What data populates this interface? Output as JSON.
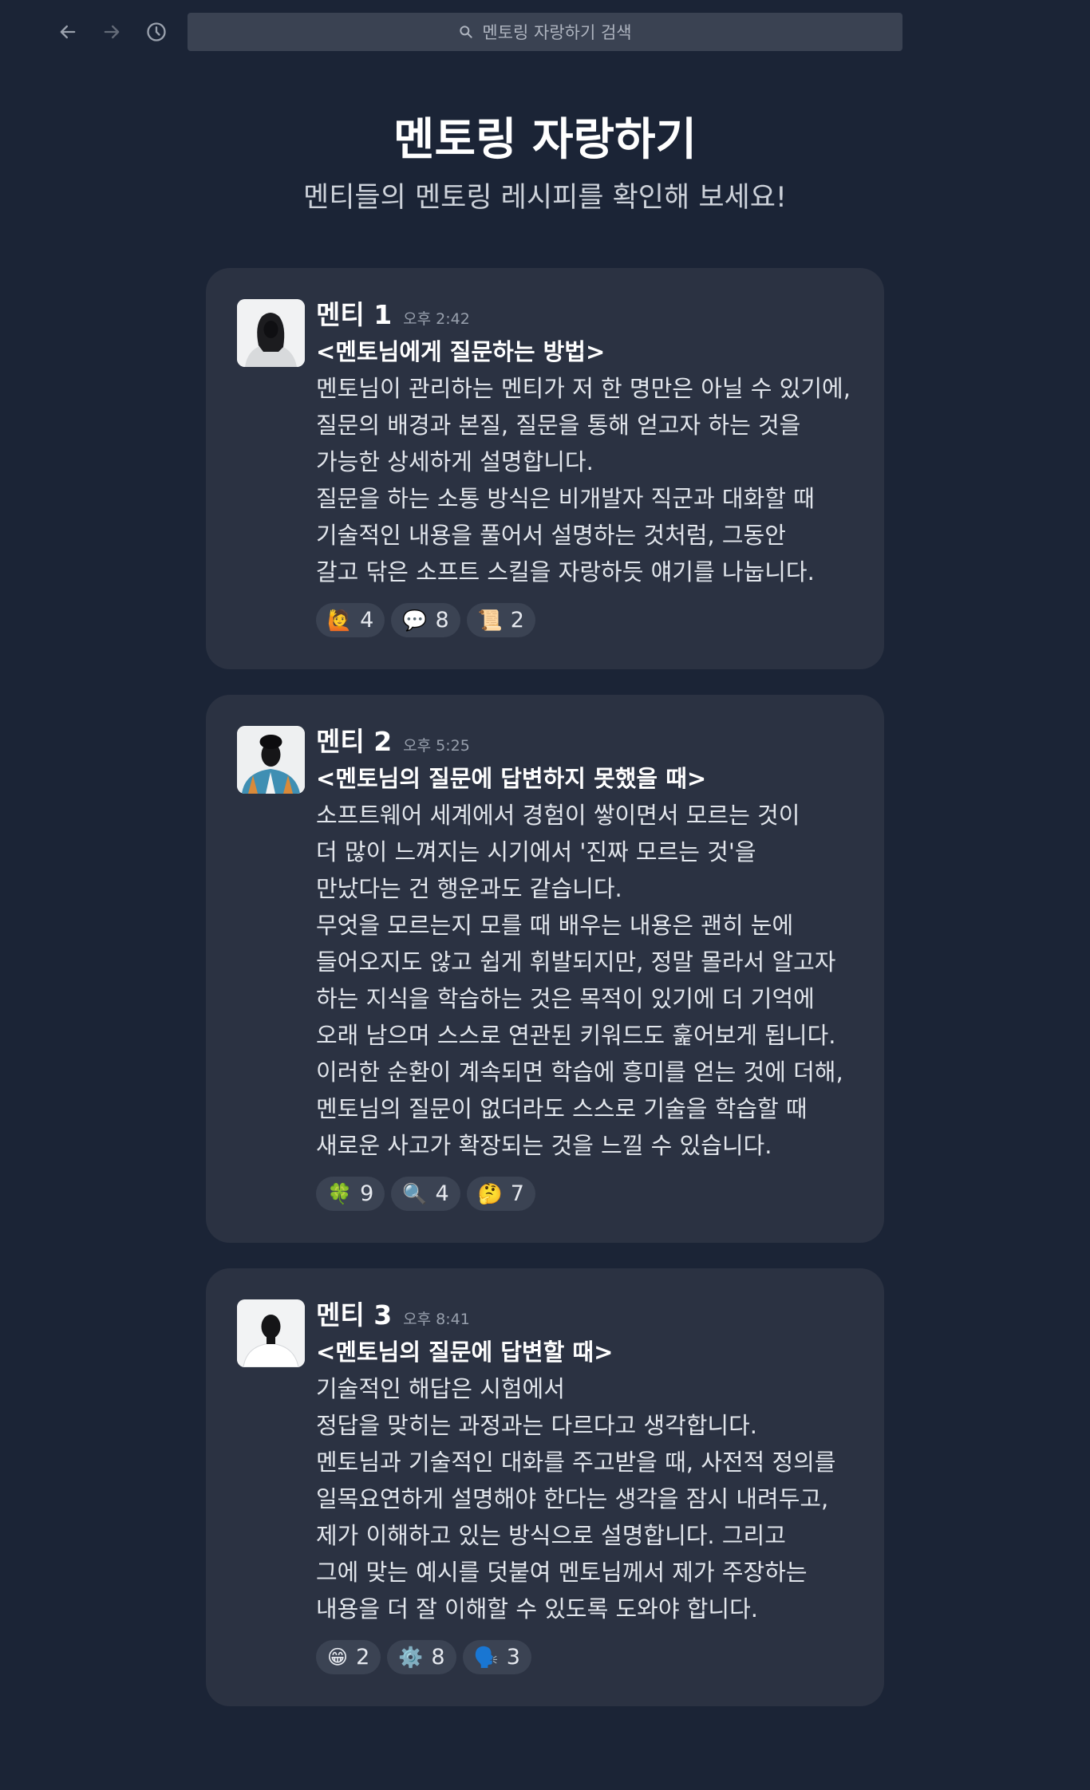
{
  "search": {
    "placeholder": "멘토링 자랑하기 검색"
  },
  "header": {
    "title": "멘토링 자랑하기",
    "subtitle": "멘티들의 멘토링 레시피를 확인해 보세요!"
  },
  "posts": [
    {
      "author": "멘티 1",
      "time": "오후 2:42",
      "title": "<멘토님에게 질문하는 방법>",
      "lines": [
        "멘토님이 관리하는 멘티가 저 한 명만은 아닐 수 있기에,",
        "질문의 배경과 본질, 질문을 통해 얻고자 하는 것을",
        "가능한 상세하게 설명합니다.",
        "질문을 하는 소통 방식은 비개발자 직군과 대화할 때",
        "기술적인 내용을 풀어서 설명하는 것처럼, 그동안",
        "갈고 닦은 소프트 스킬을 자랑하듯 얘기를 나눕니다."
      ],
      "reactions": [
        {
          "emoji": "🙋",
          "count": "4"
        },
        {
          "emoji": "💬",
          "count": "8"
        },
        {
          "emoji": "📜",
          "count": "2"
        }
      ]
    },
    {
      "author": "멘티 2",
      "time": "오후 5:25",
      "title": "<멘토님의 질문에 답변하지 못했을 때>",
      "lines": [
        "소프트웨어 세계에서 경험이 쌓이면서 모르는 것이",
        "더 많이 느껴지는 시기에서 '진짜 모르는 것'을",
        "만났다는 건 행운과도 같습니다.",
        "무엇을 모르는지 모를 때 배우는 내용은 괜히 눈에",
        "들어오지도 않고 쉽게 휘발되지만, 정말 몰라서 알고자",
        "하는 지식을 학습하는 것은 목적이 있기에 더 기억에",
        "오래 남으며 스스로 연관된 키워드도 훑어보게 됩니다.",
        "이러한 순환이 계속되면 학습에 흥미를 얻는 것에 더해,",
        "멘토님의 질문이 없더라도 스스로 기술을 학습할 때",
        "새로운 사고가 확장되는 것을 느낄 수 있습니다."
      ],
      "reactions": [
        {
          "emoji": "🍀",
          "count": "9"
        },
        {
          "emoji": "🔍",
          "count": "4"
        },
        {
          "emoji": "🤔",
          "count": "7"
        }
      ]
    },
    {
      "author": "멘티 3",
      "time": "오후 8:41",
      "title": "<멘토님의 질문에 답변할 때>",
      "lines": [
        "기술적인 해답은 시험에서",
        "정답을 맞히는 과정과는 다르다고 생각합니다.",
        "멘토님과 기술적인 대화를 주고받을 때, 사전적 정의를",
        "일목요연하게 설명해야 한다는 생각을 잠시 내려두고,",
        "제가 이해하고 있는 방식으로 설명합니다. 그리고",
        "그에 맞는 예시를 덧붙여 멘토님께서 제가 주장하는",
        "내용을 더 잘 이해할 수 있도록 도와야 합니다."
      ],
      "reactions": [
        {
          "emoji": "😁",
          "count": "2"
        },
        {
          "emoji": "⚙️",
          "count": "8"
        },
        {
          "emoji": "🗣️",
          "count": "3"
        }
      ]
    }
  ]
}
